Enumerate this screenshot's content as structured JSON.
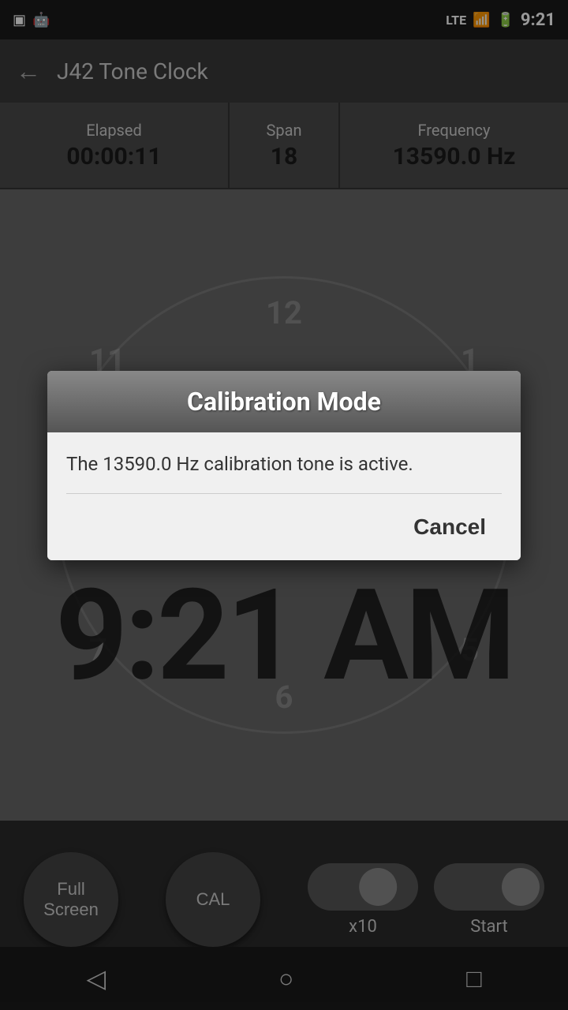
{
  "statusBar": {
    "time": "9:21",
    "lte": "LTE",
    "batteryIcon": "🔋"
  },
  "appBar": {
    "backLabel": "←",
    "title": "J42 Tone Clock"
  },
  "stats": {
    "elapsedLabel": "Elapsed",
    "elapsedValue": "00:00:11",
    "spanLabel": "Span",
    "spanValue": "18",
    "frequencyLabel": "Frequency",
    "frequencyValue": "13590.0 Hz"
  },
  "clockNumbers": [
    "12",
    "1",
    "5",
    "6",
    "7",
    "11"
  ],
  "digitalTime": "9:21 AM",
  "bottomBar": {
    "fullScreenLabel": "Full\nScreen",
    "calLabel": "CAL",
    "x10Label": "x10",
    "startLabel": "Start"
  },
  "dialog": {
    "title": "Calibration Mode",
    "message": "The 13590.0 Hz calibration tone is active.",
    "cancelLabel": "Cancel"
  },
  "navBar": {
    "backIcon": "◁",
    "homeIcon": "○",
    "recentIcon": "□"
  }
}
